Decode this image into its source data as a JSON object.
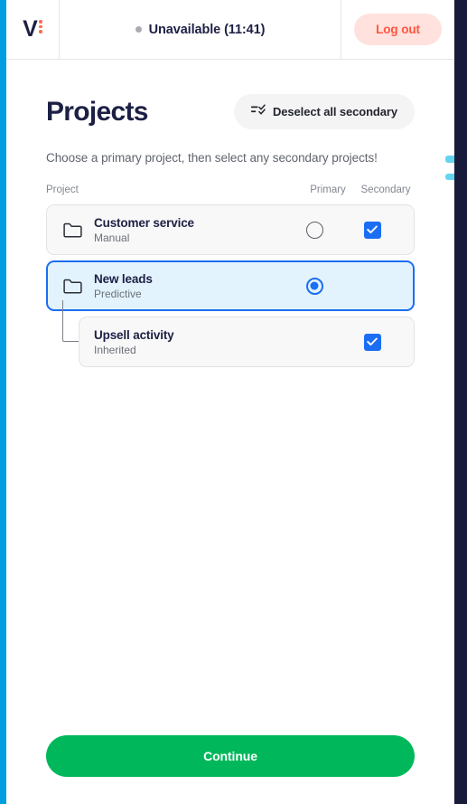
{
  "theme": {
    "left_rail_color": "#009ee0",
    "right_rail_color": "#181c3a",
    "accent_blue": "#1b6ef3",
    "brand_navy": "#1d2044",
    "brand_coral": "#ff6a52",
    "logout_bg": "#ffe1dd",
    "logout_text": "#ff5640",
    "continue_green": "#00b85b",
    "selected_row_bg": "#e3f3fd",
    "row_bg": "#f8f8f9"
  },
  "header": {
    "logo_letter": "V",
    "logo_icon": "vonage-logo-icon",
    "status_dot_icon": "status-dot-icon",
    "status_text": "Unavailable (11:41)",
    "logout_label": "Log out"
  },
  "page": {
    "title": "Projects",
    "deselect_all_label": "Deselect all secondary",
    "deselect_icon": "checklist-icon",
    "subtitle": "Choose a primary project, then select any secondary projects!"
  },
  "columns": {
    "project": "Project",
    "primary": "Primary",
    "secondary": "Secondary"
  },
  "projects": [
    {
      "name": "Customer service",
      "type": "Manual",
      "icon": "folder-icon",
      "nested": false,
      "selected": false,
      "primary_selected": false,
      "has_primary": true,
      "secondary_checked": true,
      "has_secondary": true
    },
    {
      "name": "New leads",
      "type": "Predictive",
      "icon": "folder-icon",
      "nested": false,
      "selected": true,
      "primary_selected": true,
      "has_primary": true,
      "secondary_checked": false,
      "has_secondary": false
    },
    {
      "name": "Upsell activity",
      "type": "Inherited",
      "icon": "none",
      "nested": true,
      "selected": false,
      "primary_selected": false,
      "has_primary": false,
      "secondary_checked": true,
      "has_secondary": true
    }
  ],
  "footer": {
    "continue_label": "Continue"
  }
}
